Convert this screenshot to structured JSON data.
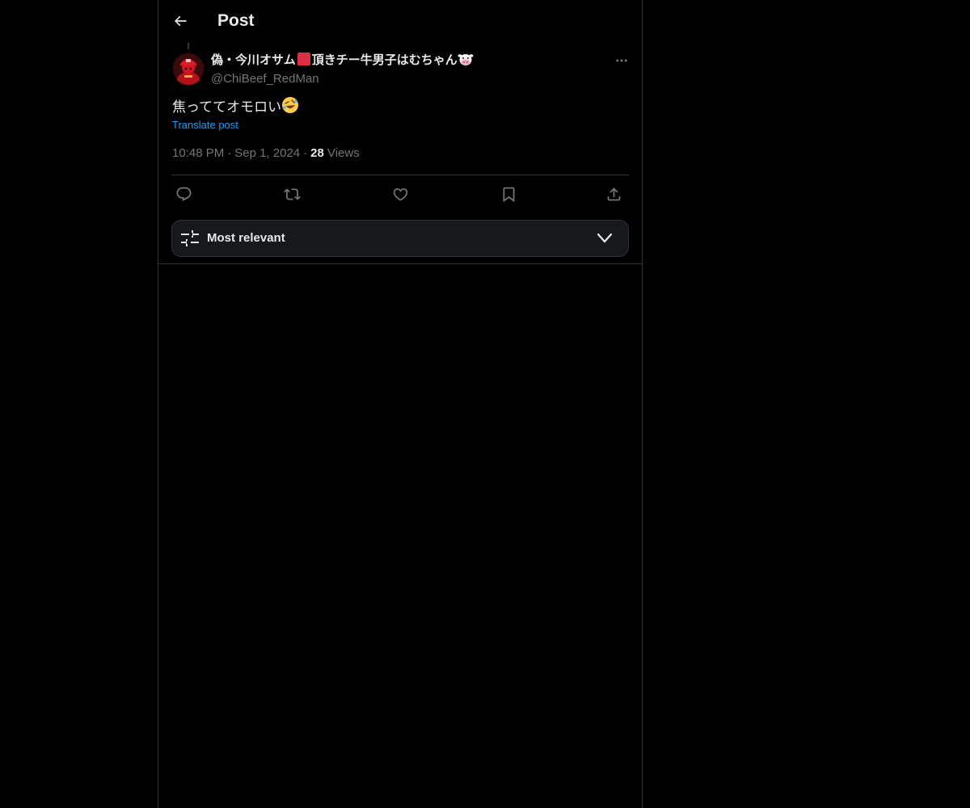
{
  "header": {
    "title": "Post",
    "back_icon": "arrow-left-icon"
  },
  "post": {
    "author": {
      "name_part1": "偽・今川オサム",
      "name_part2": "頂きチー牛男子はむちゃん",
      "name_badge_icon": "red-square-emoji",
      "name_trailing_icon": "cow-face-emoji",
      "handle": "@ChiBeef_RedMan",
      "avatar_icon": "avatar-red-figure"
    },
    "text": "焦っててオモロい",
    "text_emoji": "rolling-on-floor-laughing-emoji",
    "translate_label": "Translate post",
    "time": "10:48 PM",
    "date": "Sep 1, 2024",
    "views_count": "28",
    "views_label": "Views",
    "more_icon": "more-horizontal-icon"
  },
  "actions": {
    "reply_icon": "reply-icon",
    "repost_icon": "repost-icon",
    "like_icon": "heart-icon",
    "bookmark_icon": "bookmark-icon",
    "share_icon": "share-icon"
  },
  "sort": {
    "label": "Most relevant",
    "icon": "sliders-icon",
    "chevron": "chevron-down-icon"
  },
  "colors": {
    "background": "#000000",
    "text_primary": "#e7e9ea",
    "text_secondary": "#71767b",
    "link": "#1d9bf0",
    "border": "#2f3336"
  }
}
